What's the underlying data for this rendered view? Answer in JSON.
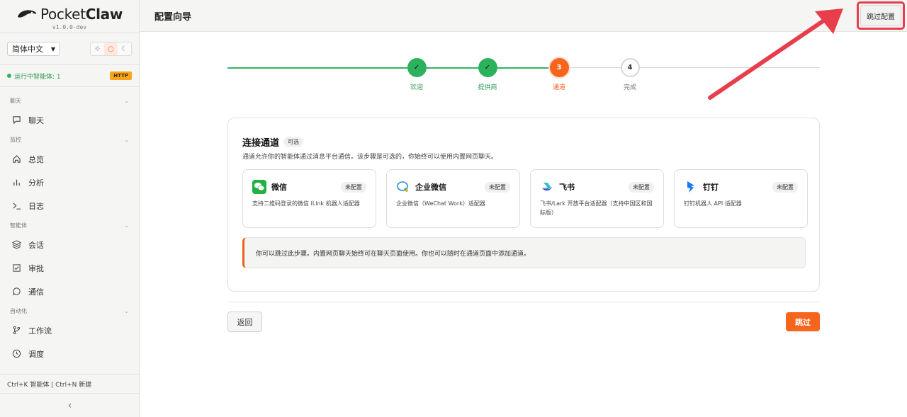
{
  "app": {
    "name_light": "Pocket",
    "name_bold": "Claw",
    "version": "v1.0.0-dev"
  },
  "sidebar": {
    "language": "简体中文",
    "status_text": "运行中智能体: 1",
    "http_badge": "HTTP",
    "sections": [
      {
        "label": "聊天",
        "items": [
          {
            "label": "聊天",
            "icon": "chat-bubble-icon"
          }
        ]
      },
      {
        "label": "监控",
        "items": [
          {
            "label": "总览",
            "icon": "home-icon"
          },
          {
            "label": "分析",
            "icon": "bar-chart-icon"
          },
          {
            "label": "日志",
            "icon": "terminal-icon"
          }
        ]
      },
      {
        "label": "智能体",
        "items": [
          {
            "label": "会话",
            "icon": "layers-icon"
          },
          {
            "label": "审批",
            "icon": "checkbox-icon"
          },
          {
            "label": "通信",
            "icon": "message-icon"
          }
        ]
      },
      {
        "label": "自动化",
        "items": [
          {
            "label": "工作流",
            "icon": "git-branch-icon"
          },
          {
            "label": "调度",
            "icon": "clock-icon"
          }
        ]
      }
    ],
    "shortcut_hint": "Ctrl+K 智能体 | Ctrl+N 新建",
    "collapse_glyph": "‹"
  },
  "header": {
    "title": "配置向导",
    "skip_setup_label": "跳过配置"
  },
  "stepper": {
    "steps": [
      {
        "marker": "✓",
        "label": "欢迎",
        "state": "done"
      },
      {
        "marker": "✓",
        "label": "提供商",
        "state": "done"
      },
      {
        "marker": "3",
        "label": "通道",
        "state": "current"
      },
      {
        "marker": "4",
        "label": "完成",
        "state": "todo"
      }
    ]
  },
  "card": {
    "title": "连接通道",
    "badge": "可选",
    "description": "通道允许你的智能体通过消息平台通信。该步骤是可选的，你始终可以使用内置网页聊天。",
    "channels": [
      {
        "name": "微信",
        "status": "未配置",
        "description": "支持二维码登录的微信 iLink 机器人适配器",
        "icon": "wechat-icon"
      },
      {
        "name": "企业微信",
        "status": "未配置",
        "description": "企业微信（WeChat Work）适配器",
        "icon": "wecom-icon"
      },
      {
        "name": "飞书",
        "status": "未配置",
        "description": "飞书/Lark 开放平台适配器（支持中国区和国际版）",
        "icon": "feishu-icon"
      },
      {
        "name": "钉钉",
        "status": "未配置",
        "description": "钉钉机器人 API 适配器",
        "icon": "dingtalk-icon"
      }
    ],
    "note": "你可以跳过此步骤。内置网页聊天始终可在聊天页面使用。你也可以随时在通道页面中添加通道。"
  },
  "footer": {
    "back_label": "返回",
    "skip_label": "跳过"
  },
  "colors": {
    "accent": "#f5651c",
    "success": "#2cb25c",
    "annotation": "#e83d4b"
  }
}
